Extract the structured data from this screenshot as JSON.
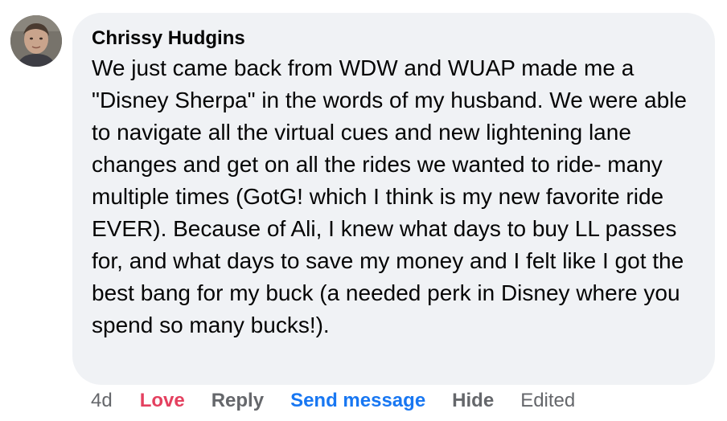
{
  "comment": {
    "author": "Chrissy Hudgins",
    "text": "We just came back from WDW and WUAP made me a \"Disney Sherpa\" in the words of my husband. We were able to navigate all the virtual cues and new lightening lane changes and get on all the rides we wanted to ride- many multiple times (GotG! which I think is my new favorite ride EVER). Because of Ali, I knew what days to buy LL passes for, and what days to save my money and I felt like I got the best bang for my buck (a needed perk in Disney where you spend so many bucks!)."
  },
  "actions": {
    "time": "4d",
    "love": "Love",
    "reply": "Reply",
    "send_message": "Send message",
    "hide": "Hide",
    "edited": "Edited"
  },
  "colors": {
    "bubble_bg": "#f0f2f5",
    "text": "#050505",
    "secondary": "#65676b",
    "love": "#e4405f",
    "link_blue": "#1877f2"
  }
}
